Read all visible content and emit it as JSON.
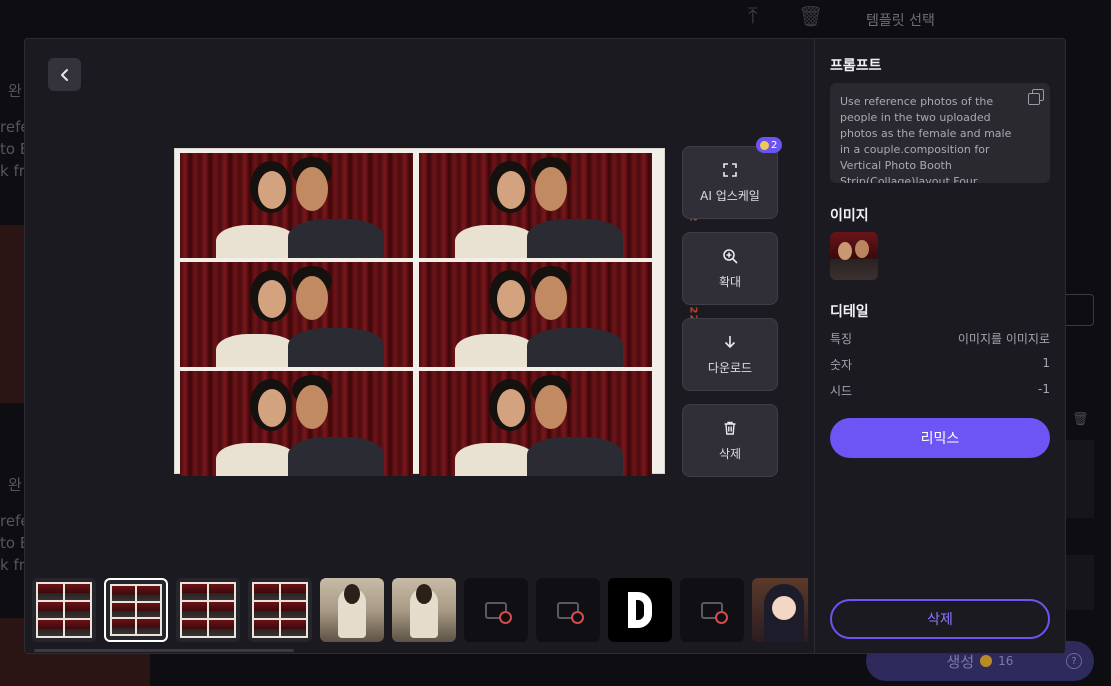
{
  "background": {
    "template_title": "템플릿 선택",
    "side_text_1": "완",
    "side_text_2": "refe",
    "side_text_3": "to B",
    "side_text_4": "k fra",
    "side_text_5": "완",
    "side_text_6": "refe",
    "side_text_7": "to B",
    "side_text_8": "k fra",
    "generate_label": "생성",
    "generate_cost": "16"
  },
  "viewer": {
    "strip_side_text": [
      "5222",
      "5222",
      "502"
    ],
    "actions": {
      "upscale_label": "AI 업스케일",
      "upscale_cost": "2",
      "zoom_label": "확대",
      "download_label": "다운로드",
      "delete_label": "삭제"
    },
    "thumbnails": [
      {
        "type": "strip2"
      },
      {
        "type": "grid",
        "selected": true
      },
      {
        "type": "grid"
      },
      {
        "type": "strip2"
      },
      {
        "type": "portrait"
      },
      {
        "type": "portrait"
      },
      {
        "type": "broken"
      },
      {
        "type": "broken"
      },
      {
        "type": "logo"
      },
      {
        "type": "broken"
      },
      {
        "type": "anime"
      }
    ]
  },
  "panel": {
    "prompt_title": "프롬프트",
    "prompt_text": "Use reference photos of the people in the two uploaded photos as the female and male in a couple.composition for Vertical Photo Booth Strip(Collage)layout Four vertical frames arranged in a",
    "image_title": "이미지",
    "detail_title": "디테일",
    "details": [
      {
        "label": "특징",
        "value": "이미지를 이미지로"
      },
      {
        "label": "숫자",
        "value": "1"
      },
      {
        "label": "시드",
        "value": "-1"
      }
    ],
    "remix_label": "리믹스",
    "delete_label": "삭제"
  },
  "colors": {
    "accent": "#6c54f5",
    "panel_bg": "#1b1a21",
    "button_bg": "#302f37"
  }
}
